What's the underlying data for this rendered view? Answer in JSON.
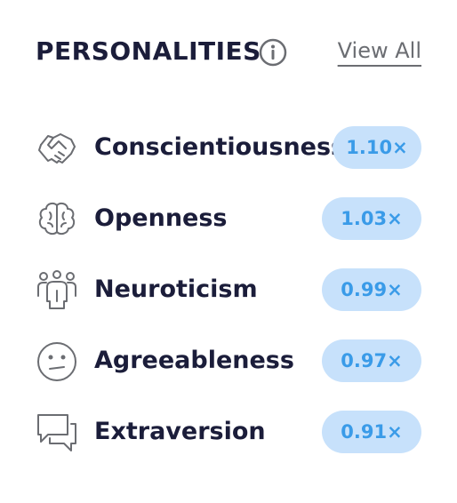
{
  "header": {
    "title": "PERSONALITIES",
    "info_icon": "info-circle-icon",
    "view_all_label": "View All"
  },
  "items": [
    {
      "label": "Conscientiousness",
      "value": "1.10×",
      "icon": "handshake-icon"
    },
    {
      "label": "Openness",
      "value": "1.03×",
      "icon": "brain-icon"
    },
    {
      "label": "Neuroticism",
      "value": "0.99×",
      "icon": "people-group-icon"
    },
    {
      "label": "Agreeableness",
      "value": "0.97×",
      "icon": "neutral-face-icon"
    },
    {
      "label": "Extraversion",
      "value": "0.91×",
      "icon": "speech-bubbles-icon"
    }
  ],
  "colors": {
    "title": "#1b1d3a",
    "badge_bg": "#c7e1fb",
    "badge_text": "#3a9be8",
    "icon_stroke": "#6b6d72"
  }
}
